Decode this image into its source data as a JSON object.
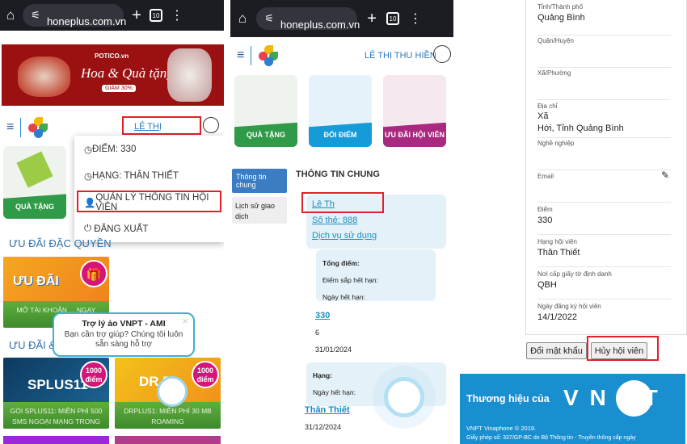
{
  "browser": {
    "url": " honeplus.com.vn",
    "tab_count": "10"
  },
  "left": {
    "banner": {
      "brand": "POTICO.vn",
      "headline": "Hoa & Quà tặng",
      "promo": "GIẢM 30%"
    },
    "user_name": "LÊ THỊ",
    "tiles": [
      {
        "label": "QUÀ TẶNG"
      }
    ],
    "dropdown": {
      "items": [
        {
          "label": "ĐIỂM: 330"
        },
        {
          "label": "HẠNG: THÂN THIẾT"
        },
        {
          "label": "QUẢN LÝ THÔNG TIN HỘI VIÊN"
        },
        {
          "label": "ĐĂNG XUẤT"
        }
      ]
    },
    "section1": "ƯU ĐÃI ĐẶC QUYỀN",
    "section2": "ƯU ĐÃI &",
    "promo_card": {
      "title": "ƯU ĐÃI",
      "caption": "MỞ TÀI KHOẢN ... NGAY"
    },
    "cards": [
      {
        "badge_top": "1000",
        "badge_bottom": "điểm",
        "art": "SPLUS11",
        "caption": "GÓI SPLUS11: MIỄN PHÍ 500 SMS NGOẠI MẠNG TRONG"
      },
      {
        "badge_top": "1000",
        "badge_bottom": "điểm",
        "art": "DR PL",
        "caption": "DRPLUS1: MIỄN PHÍ 30 MB ROAMING"
      }
    ],
    "chat_tooltip": {
      "title": "Trợ lý ảo VNPT - AMI",
      "body": "Bạn cần trợ giúp? Chúng tôi luôn sẵn sàng hỗ trợ",
      "close": "×"
    }
  },
  "middle": {
    "user_name": "LÊ THỊ THU HIỀN",
    "tiles": [
      {
        "label": "QUÀ TẶNG",
        "color": "#2f9a47"
      },
      {
        "label": "ĐỔI ĐIỂM",
        "color": "#169bd9"
      },
      {
        "label": "ƯU ĐÃI HỘI VIÊN",
        "color": "#a8297f"
      }
    ],
    "side_tabs": [
      {
        "label": "Thông tin chung",
        "active": true
      },
      {
        "label": "Lịch sử giao dịch",
        "active": false
      }
    ],
    "heading": "THÔNG TIN CHUNG",
    "member_name": "Lê Th",
    "card_no": "Số thẻ: 888",
    "services_link": "Dịch vụ sử dụng",
    "points_box": {
      "total_label": "Tổng điểm:",
      "expiring_label": "Điểm sắp hết hạn:",
      "expiry_label": "Ngày hết hạn:"
    },
    "points_total": "330",
    "points_expiring": "6",
    "points_expiry": "31/01/2024",
    "rank_box": {
      "rank_label": "Hạng:",
      "expiry_label": "Ngày hết hạn:"
    },
    "rank": "Thân Thiết",
    "rank_expiry": "31/12/2024"
  },
  "right": {
    "fields": [
      {
        "label": "Tỉnh/Thành phố",
        "value": "Quảng Bình"
      },
      {
        "label": "Quận/Huyện",
        "value": ""
      },
      {
        "label": "Xã/Phường",
        "value": ""
      },
      {
        "label": "Địa chỉ",
        "value": "Xã\nHới, Tỉnh Quảng Bình"
      },
      {
        "label": "Nghề nghiệp",
        "value": ""
      },
      {
        "label": "Email",
        "value": ""
      },
      {
        "label": "Điểm",
        "value": "330"
      },
      {
        "label": "Hạng hội viên",
        "value": "Thân Thiết"
      },
      {
        "label": "Nơi cấp giấy tờ định danh",
        "value": "QBH"
      },
      {
        "label": "Ngày đăng ký hội viên",
        "value": "14/1/2022"
      }
    ],
    "change_password": "Đổi mật khẩu",
    "cancel_membership": "Hủy hội viên",
    "footer": {
      "brand_text": "Thương hiệu của",
      "logo_text": "VNPT",
      "copyright": "VNPT Vinaphone © 2019.",
      "license": "Giấy phép số: 337/GP-BC do Bộ Thông tin - Truyền thông cấp ngày"
    }
  },
  "colors": {
    "highlight": "#e3202a",
    "link": "#1a8fbf",
    "footer": "#1a8fd0"
  }
}
